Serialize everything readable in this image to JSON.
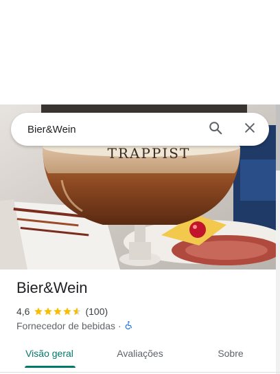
{
  "search": {
    "value": "Bier&Wein"
  },
  "place": {
    "title": "Bier&Wein",
    "rating": "4,6",
    "rating_stars": 4.6,
    "review_count": "(100)",
    "category": "Fornecedor de bebidas",
    "separator": "·"
  },
  "photo": {
    "glass_text": "TRAPPIST"
  },
  "tabs": [
    {
      "label": "Visão geral",
      "active": true
    },
    {
      "label": "Avaliações",
      "active": false
    },
    {
      "label": "Sobre",
      "active": false
    }
  ],
  "colors": {
    "accent": "#00796b",
    "star": "#fbbc04",
    "accessibility": "#1a73e8"
  },
  "icons": {
    "search": "search-icon",
    "close": "close-icon",
    "accessible": "wheelchair-icon"
  }
}
